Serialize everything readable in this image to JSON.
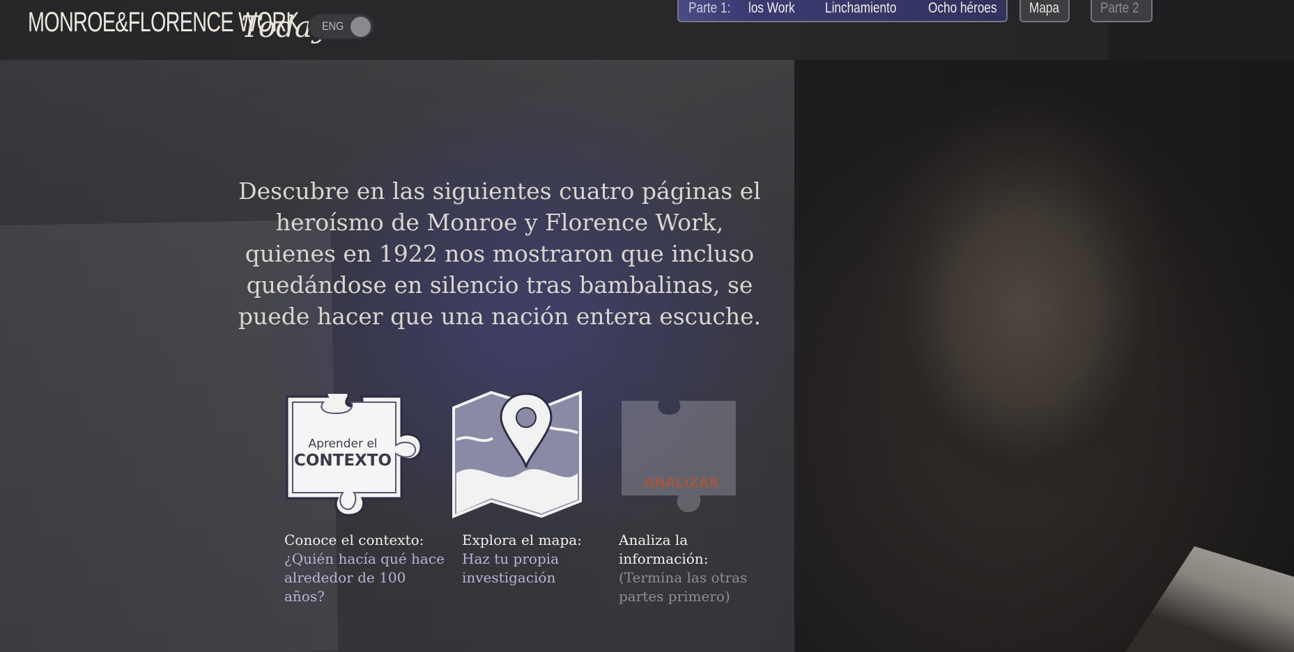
{
  "logo": {
    "main": "MONROE&FLORENCE WORK",
    "today": "Today"
  },
  "lang_toggle": {
    "label": "ENG"
  },
  "nav": {
    "part1_label": "Parte 1:",
    "items": [
      "los Work",
      "Linchamiento",
      "Ocho héroes"
    ],
    "map": "Mapa",
    "part2": "Parte 2"
  },
  "headline": "Descubre en las siguientes cuatro páginas el heroísmo de Monroe y Florence Work, quienes en 1922 nos mostraron que incluso quedándose en silencio tras bambalinas, se puede hacer que una nación entera escuche.",
  "cards": [
    {
      "icon_line1": "Aprender el",
      "icon_line2": "CONTEXTO",
      "title": "Conoce el contexto:",
      "subtitle": "¿Quién hacía qué hace alrededor de 100 años?"
    },
    {
      "title": "Explora el mapa:",
      "subtitle": "Haz tu propia investigación"
    },
    {
      "icon_label": "ANALIZAR",
      "title": "Analiza la información:",
      "subtitle": "(Termina las otras partes primero)"
    }
  ],
  "colors": {
    "accent_nav": "#3b3b72",
    "link_text": "#b7b5d8",
    "disabled_text": "#8e8e92",
    "disabled_icon_label": "#b3543a"
  }
}
